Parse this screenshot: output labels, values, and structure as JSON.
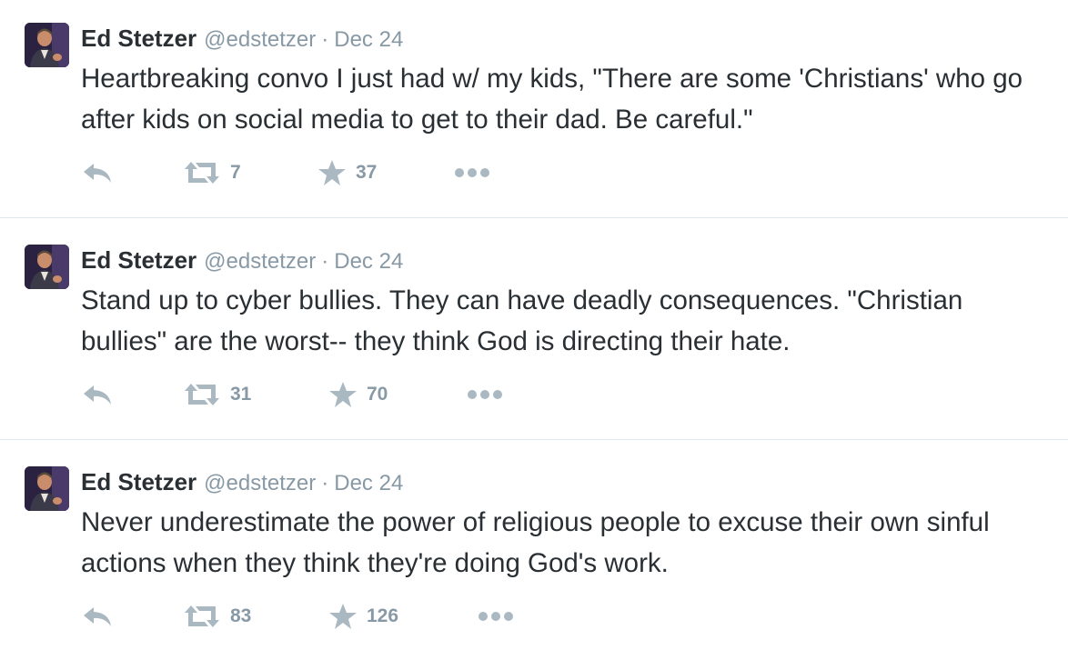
{
  "tweets": [
    {
      "author_name": "Ed Stetzer",
      "handle": "@edstetzer",
      "separator": "·",
      "date": "Dec 24",
      "text": "Heartbreaking convo I just had w/ my kids, \"There are some 'Christians' who go after kids on social media to get to their dad. Be careful.\"",
      "retweets": "7",
      "favorites": "37"
    },
    {
      "author_name": "Ed Stetzer",
      "handle": "@edstetzer",
      "separator": "·",
      "date": "Dec 24",
      "text": "Stand up to cyber bullies. They can have deadly consequences. \"Christian bullies\" are the worst-- they think God is directing their hate.",
      "retweets": "31",
      "favorites": "70"
    },
    {
      "author_name": "Ed Stetzer",
      "handle": "@edstetzer",
      "separator": "·",
      "date": "Dec 24",
      "text": "Never underestimate the power of religious people to excuse their own sinful actions when they think they're doing God's work.",
      "retweets": "83",
      "favorites": "126"
    }
  ],
  "icons": {
    "reply": "reply-icon",
    "retweet": "retweet-icon",
    "favorite": "star-icon",
    "more": "more-icon"
  },
  "colors": {
    "text": "#292f33",
    "muted": "#8899a6",
    "icon": "#aab8c2",
    "divider": "#e1e8ed"
  }
}
